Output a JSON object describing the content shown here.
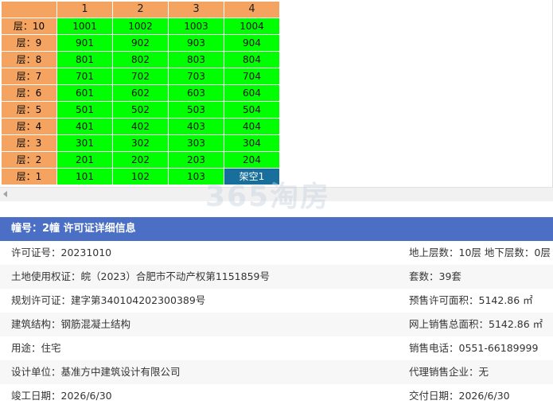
{
  "grid": {
    "columns": [
      "1",
      "2",
      "3",
      "4"
    ],
    "floor_prefix": "层：",
    "rows": [
      {
        "floor": "10",
        "units": [
          "1001",
          "1002",
          "1003",
          "1004"
        ],
        "status": [
          "sold",
          "sold",
          "sold",
          "sold"
        ]
      },
      {
        "floor": "9",
        "units": [
          "901",
          "902",
          "903",
          "904"
        ],
        "status": [
          "sold",
          "sold",
          "sold",
          "sold"
        ]
      },
      {
        "floor": "8",
        "units": [
          "801",
          "802",
          "803",
          "804"
        ],
        "status": [
          "sold",
          "sold",
          "sold",
          "sold"
        ]
      },
      {
        "floor": "7",
        "units": [
          "701",
          "702",
          "703",
          "704"
        ],
        "status": [
          "sold",
          "sold",
          "sold",
          "sold"
        ]
      },
      {
        "floor": "6",
        "units": [
          "601",
          "602",
          "603",
          "604"
        ],
        "status": [
          "sold",
          "sold",
          "sold",
          "sold"
        ]
      },
      {
        "floor": "5",
        "units": [
          "501",
          "502",
          "503",
          "504"
        ],
        "status": [
          "sold",
          "sold",
          "sold",
          "sold"
        ]
      },
      {
        "floor": "4",
        "units": [
          "401",
          "402",
          "403",
          "404"
        ],
        "status": [
          "sold",
          "sold",
          "sold",
          "sold"
        ]
      },
      {
        "floor": "3",
        "units": [
          "301",
          "302",
          "303",
          "304"
        ],
        "status": [
          "sold",
          "sold",
          "sold",
          "sold"
        ]
      },
      {
        "floor": "2",
        "units": [
          "201",
          "202",
          "203",
          "204"
        ],
        "status": [
          "sold",
          "sold",
          "sold",
          "sold"
        ]
      },
      {
        "floor": "1",
        "units": [
          "101",
          "102",
          "103",
          "架空1"
        ],
        "status": [
          "sold",
          "sold",
          "sold",
          "empty"
        ]
      }
    ],
    "colors": {
      "header": "#f4a460",
      "sold": "#00ff00",
      "empty": "#186f9b"
    }
  },
  "watermark": {
    "big": "365淘房",
    "small": "www.house365.com"
  },
  "panel": {
    "title": "幢号：2幢 许可证详细信息",
    "rows": [
      {
        "left_label": "许可证号：",
        "left_value": "20231010",
        "right_label": "地上层数：",
        "right_value": "10层  地下层数：0层"
      },
      {
        "left_label": "土地使用权证：",
        "left_value": "皖（2023）合肥市不动产权第1151859号",
        "right_label": "套数：",
        "right_value": "39套"
      },
      {
        "left_label": "规划许可证：",
        "left_value": "建字第340104202300389号",
        "right_label": "预售许可面积：",
        "right_value": "5142.86 ㎡"
      },
      {
        "left_label": "建筑结构：",
        "left_value": "钢筋混凝土结构",
        "right_label": "网上销售总面积：",
        "right_value": "5142.86 ㎡"
      },
      {
        "left_label": "用途：",
        "left_value": "住宅",
        "right_label": "销售电话：",
        "right_value": "0551-66189999"
      },
      {
        "left_label": "设计单位：",
        "left_value": "基准方中建筑设计有限公司",
        "right_label": "代理销售企业：",
        "right_value": "无"
      },
      {
        "left_label": "竣工日期：",
        "left_value": "2026/6/30",
        "right_label": "交付日期：",
        "right_value": "2026/6/30"
      }
    ],
    "header_color": "#4a6fc4"
  }
}
